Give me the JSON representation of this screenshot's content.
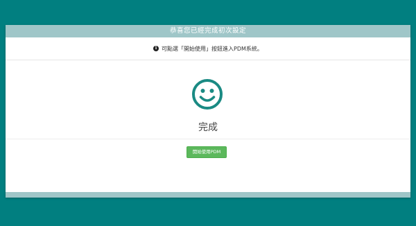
{
  "dialog": {
    "title": "恭喜您已經完成初次設定",
    "notice_icon": "info-circle-icon",
    "notice_text": "可點選「開始使用」按鈕進入PDM系統。",
    "status_icon": "smiley-face-icon",
    "status_label": "完成",
    "start_button_label": "開始使用PDM"
  },
  "colors": {
    "background": "#017f80",
    "header": "#9fc6c8",
    "smiley": "#1a8a83",
    "button": "#5cb85c"
  }
}
